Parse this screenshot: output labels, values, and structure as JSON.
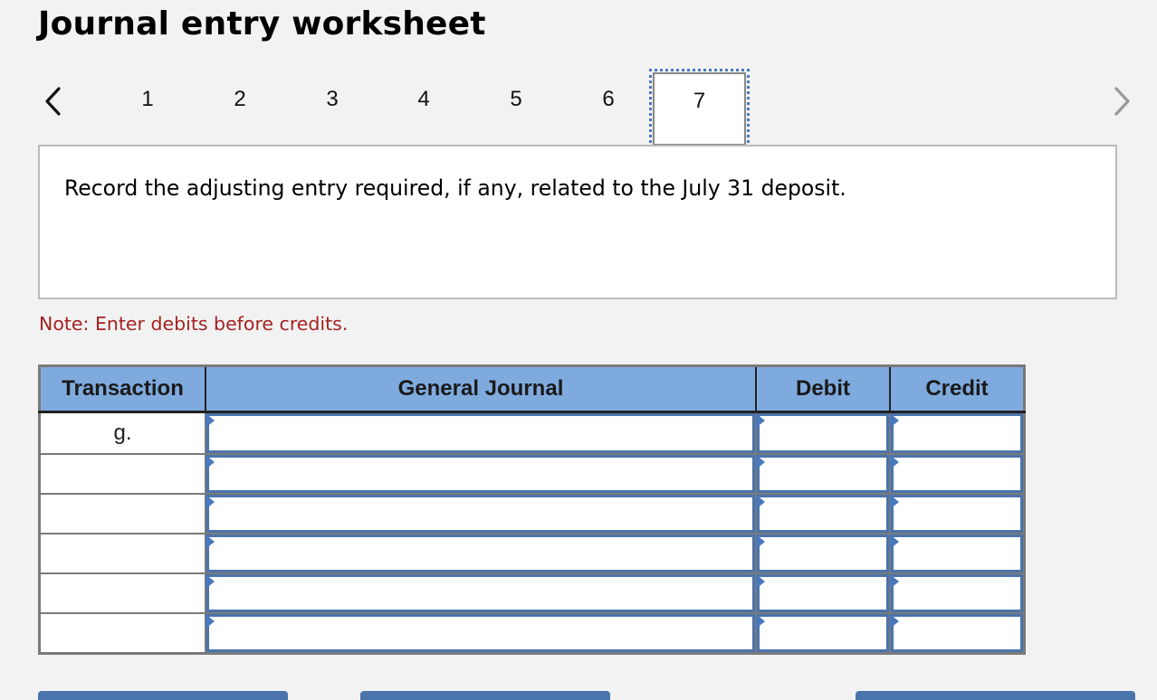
{
  "header": {
    "title": "Journal entry worksheet"
  },
  "pagination": {
    "prev_icon": "chevron-left-icon",
    "next_icon": "chevron-right-icon",
    "pages": [
      "1",
      "2",
      "3",
      "4",
      "5",
      "6",
      "7"
    ],
    "current_page": "7"
  },
  "prompt": {
    "text": "Record the adjusting entry required, if any, related to the July 31 deposit."
  },
  "note": {
    "text": "Note: Enter debits before credits."
  },
  "journal": {
    "columns": [
      "Transaction",
      "General Journal",
      "Debit",
      "Credit"
    ],
    "rows": [
      {
        "transaction": "g.",
        "account": "",
        "debit": "",
        "credit": ""
      },
      {
        "transaction": "",
        "account": "",
        "debit": "",
        "credit": ""
      },
      {
        "transaction": "",
        "account": "",
        "debit": "",
        "credit": ""
      },
      {
        "transaction": "",
        "account": "",
        "debit": "",
        "credit": ""
      },
      {
        "transaction": "",
        "account": "",
        "debit": "",
        "credit": ""
      },
      {
        "transaction": "",
        "account": "",
        "debit": "",
        "credit": ""
      }
    ]
  },
  "colors": {
    "header_fill": "#7faade",
    "input_border": "#4a74ac",
    "note_text": "#a52222",
    "focus_outline": "#4a78bd"
  }
}
